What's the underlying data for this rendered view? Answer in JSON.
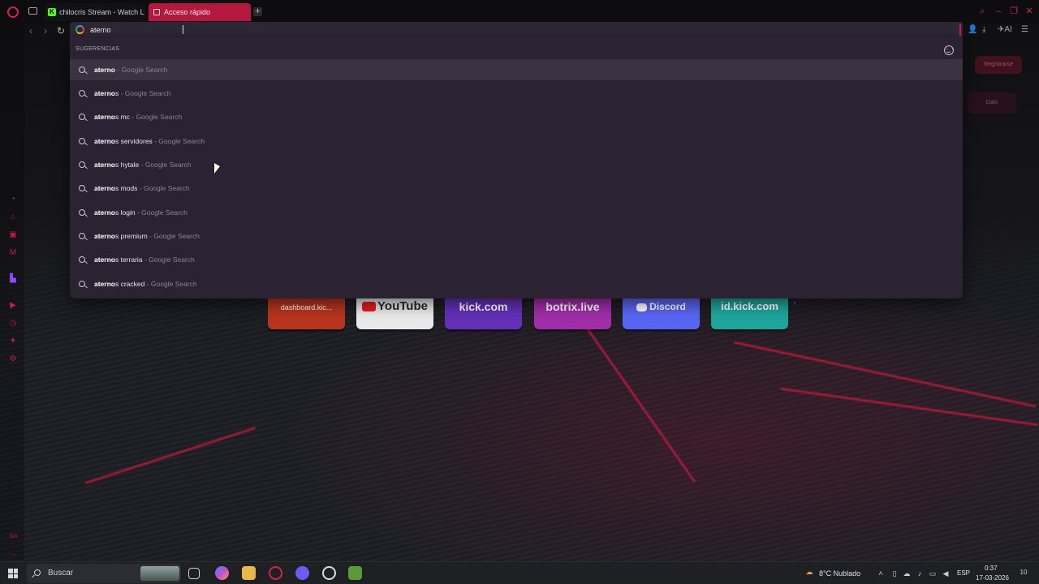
{
  "browser": {
    "tabs": [
      {
        "label": "chilocris Stream - Watch L",
        "favicon": "kick-icon"
      },
      {
        "label": "Acceso rápido",
        "favicon": "speed-dial-icon",
        "active": true
      }
    ],
    "accent_color": "#c41e48"
  },
  "address_bar": {
    "value": "aterno"
  },
  "suggestions": {
    "header": "SUGERENCIAS",
    "items": [
      {
        "bold": "aterno",
        "rest": "",
        "source": "Google Search"
      },
      {
        "bold": "aterno",
        "rest": "s",
        "source": "Google Search"
      },
      {
        "bold": "aterno",
        "rest": "s mc",
        "source": "Google Search"
      },
      {
        "bold": "aterno",
        "rest": "s servidores",
        "source": "Google Search"
      },
      {
        "bold": "aterno",
        "rest": "s hytale",
        "source": "Google Search"
      },
      {
        "bold": "aterno",
        "rest": "s mods",
        "source": "Google Search"
      },
      {
        "bold": "aterno",
        "rest": "s login",
        "source": "Google Search"
      },
      {
        "bold": "aterno",
        "rest": "s premium",
        "source": "Google Search"
      },
      {
        "bold": "aterno",
        "rest": "s terraria",
        "source": "Google Search"
      },
      {
        "bold": "aterno",
        "rest": "s cracked",
        "source": "Google Search"
      }
    ]
  },
  "speed_dials": [
    {
      "label": "dashboard.kic...",
      "color": "#b8351f"
    },
    {
      "label": "YouTube",
      "color": "#e9e9ea"
    },
    {
      "label": "kick.com",
      "color": "#6330b8"
    },
    {
      "label": "botrix.live",
      "color": "#a02ea8"
    },
    {
      "label": "Discord",
      "color": "#5865f2"
    },
    {
      "label": "id.kick.com",
      "color": "#1fa69c"
    }
  ],
  "page": {
    "register_label": "Registrarse",
    "other_label": "Dalo"
  },
  "sidebar_bottom_label": "GX",
  "taskbar": {
    "search_placeholder": "Buscar",
    "weather": "8°C  Nublado",
    "language": "ESP",
    "time": "0:37",
    "date": "17-03-2026",
    "notifications": "10"
  }
}
